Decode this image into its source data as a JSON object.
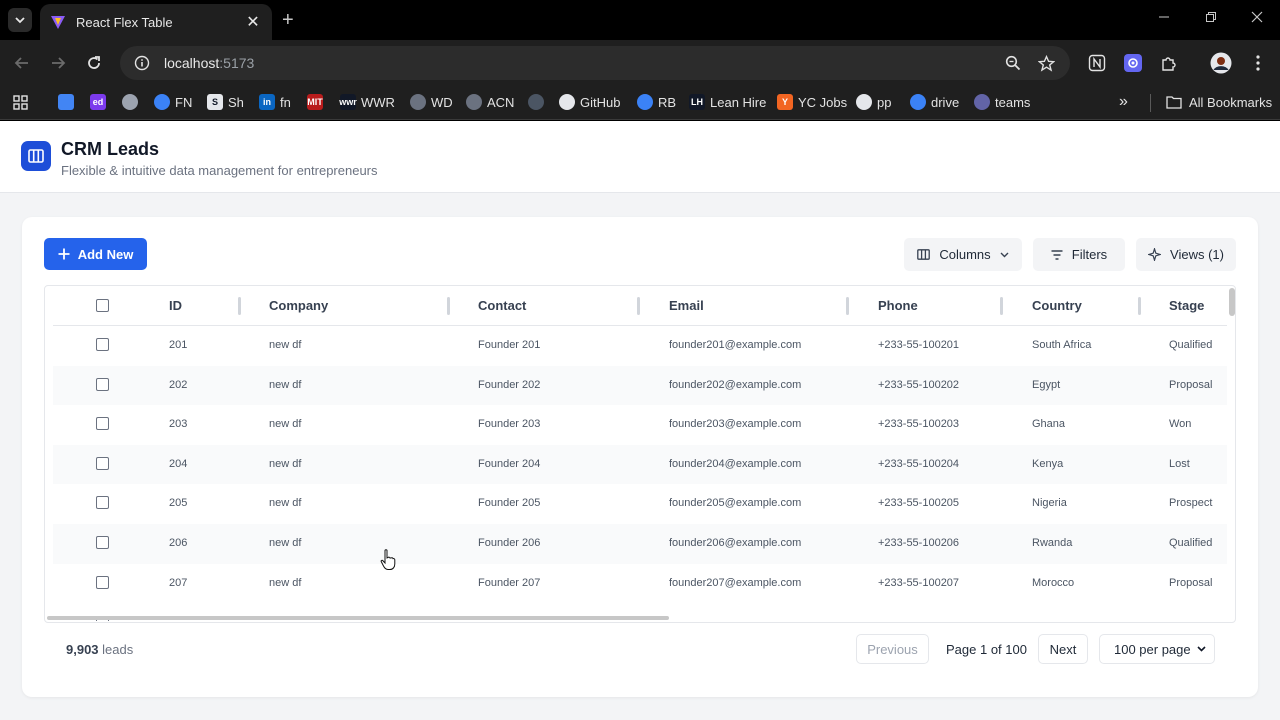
{
  "browser": {
    "tab_title": "React Flex Table",
    "tab_close": "✕",
    "new_tab": "+",
    "url_host": "localhost",
    "url_port": ":5173",
    "bookmarks": [
      {
        "label": "",
        "icon": "grid-apps-icon",
        "color": "#e3e3e3"
      },
      {
        "label": "",
        "icon": "docs-icon",
        "color": "#4285f4"
      },
      {
        "label": "",
        "icon": "ed-icon",
        "color": "#7c3aed",
        "glyph": "ed"
      },
      {
        "label": "",
        "icon": "apple-icon",
        "color": "#9ca3af"
      },
      {
        "label": "FN",
        "icon": "cloud-icon",
        "color": "#3b82f6"
      },
      {
        "label": "Sh",
        "icon": "s-icon",
        "color": "#e5e7eb",
        "glyph": "S"
      },
      {
        "label": "fn",
        "icon": "linkedin-icon",
        "color": "#0a66c2",
        "glyph": "in"
      },
      {
        "label": "",
        "icon": "mit-icon",
        "color": "#b91c1c",
        "glyph": "MIT"
      },
      {
        "label": "WWR",
        "icon": "wwr-icon",
        "color": "#111827",
        "glyph": "wwr"
      },
      {
        "label": "WD",
        "icon": "wd-icon",
        "color": "#6b7280"
      },
      {
        "label": "ACN",
        "icon": "acn-icon",
        "color": "#6b7280"
      },
      {
        "label": "",
        "icon": "circle-icon",
        "color": "#4b5563"
      },
      {
        "label": "GitHub",
        "icon": "github-icon",
        "color": "#e5e7eb"
      },
      {
        "label": "RB",
        "icon": "rb-icon",
        "color": "#3b82f6"
      },
      {
        "label": "Lean Hire",
        "icon": "lh-icon",
        "color": "#111827",
        "glyph": "LH"
      },
      {
        "label": "YC Jobs",
        "icon": "yc-icon",
        "color": "#f26522",
        "glyph": "Y"
      },
      {
        "label": "pp",
        "icon": "github-icon",
        "color": "#e5e7eb"
      },
      {
        "label": "drive",
        "icon": "cloud-icon",
        "color": "#3b82f6"
      },
      {
        "label": "teams",
        "icon": "teams-icon",
        "color": "#6264a7"
      }
    ],
    "more_bookmarks": "»",
    "all_bookmarks": "All Bookmarks"
  },
  "app": {
    "title": "CRM Leads",
    "subtitle": "Flexible & intuitive data management for entrepreneurs",
    "add_new": "Add New",
    "columns_btn": "Columns",
    "filters_btn": "Filters",
    "views_btn": "Views (1)"
  },
  "table": {
    "headers": [
      "ID",
      "Company",
      "Contact",
      "Email",
      "Phone",
      "Country",
      "Stage"
    ],
    "rows": [
      [
        "201",
        "new df",
        "Founder 201",
        "founder201@example.com",
        "+233-55-100201",
        "South Africa",
        "Qualified"
      ],
      [
        "202",
        "new df",
        "Founder 202",
        "founder202@example.com",
        "+233-55-100202",
        "Egypt",
        "Proposal"
      ],
      [
        "203",
        "new df",
        "Founder 203",
        "founder203@example.com",
        "+233-55-100203",
        "Ghana",
        "Won"
      ],
      [
        "204",
        "new df",
        "Founder 204",
        "founder204@example.com",
        "+233-55-100204",
        "Kenya",
        "Lost"
      ],
      [
        "205",
        "new df",
        "Founder 205",
        "founder205@example.com",
        "+233-55-100205",
        "Nigeria",
        "Prospect"
      ],
      [
        "206",
        "new df",
        "Founder 206",
        "founder206@example.com",
        "+233-55-100206",
        "Rwanda",
        "Qualified"
      ],
      [
        "207",
        "new df",
        "Founder 207",
        "founder207@example.com",
        "+233-55-100207",
        "Morocco",
        "Proposal"
      ]
    ]
  },
  "footer": {
    "count": "9,903",
    "count_suffix": "leads",
    "previous": "Previous",
    "page_info": "Page 1 of 100",
    "next": "Next",
    "per_page": "100 per page"
  },
  "colors": {
    "accent": "#2563eb",
    "logo": "#1d4ed8"
  }
}
